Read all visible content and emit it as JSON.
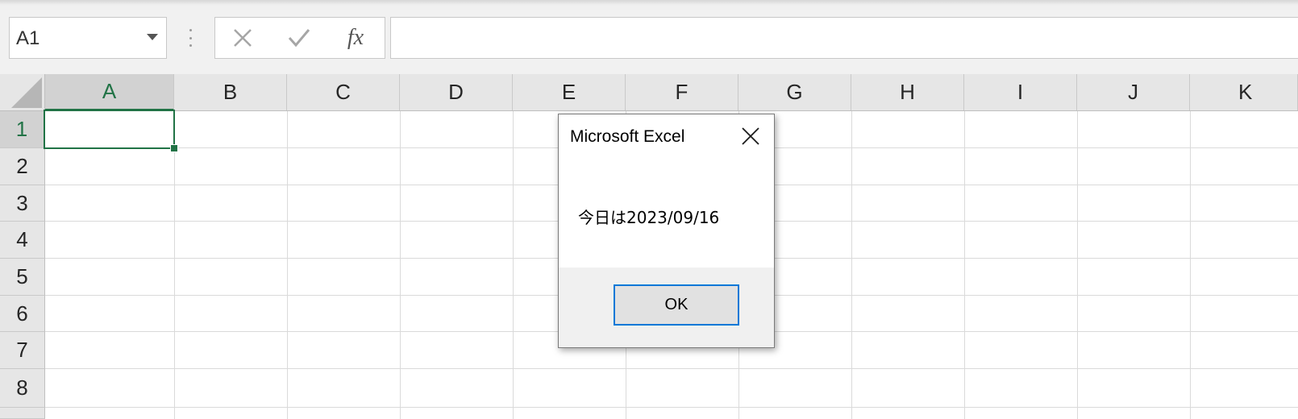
{
  "formula_bar": {
    "name_box": "A1",
    "cancel_icon": "x-icon",
    "enter_icon": "check-icon",
    "function_label": "fx",
    "formula_value": ""
  },
  "columns": [
    "A",
    "B",
    "C",
    "D",
    "E",
    "F",
    "G",
    "H",
    "I",
    "J",
    "K"
  ],
  "rows": [
    "1",
    "2",
    "3",
    "4",
    "5",
    "6",
    "7",
    "8"
  ],
  "selected_cell": "A1",
  "accent_color": "#217346",
  "dialog": {
    "title": "Microsoft Excel",
    "message": "今日は2023/09/16",
    "ok_label": "OK",
    "focus_color": "#0078d7"
  }
}
